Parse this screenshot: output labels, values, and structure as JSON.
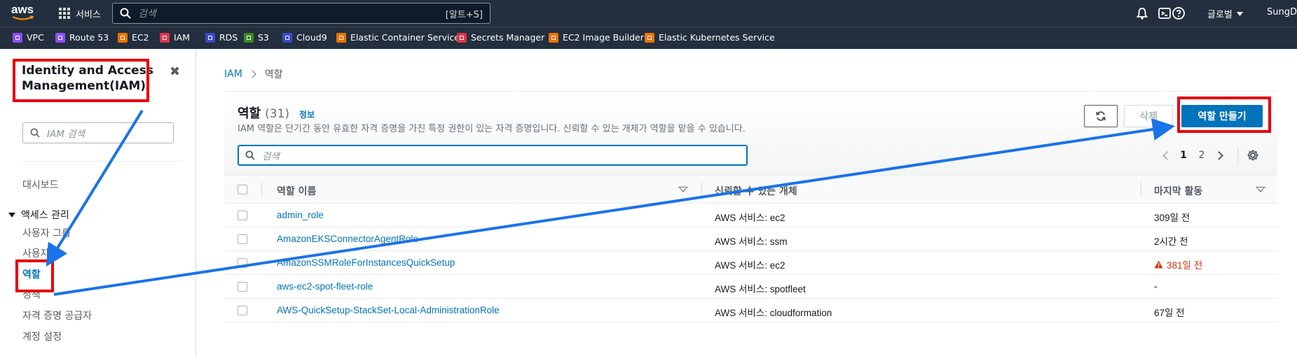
{
  "topnav": {
    "logo_text": "aws",
    "services_label": "서비스",
    "search_placeholder": "검색",
    "search_shortcut": "[알트+S]",
    "region_label": "글로벌",
    "user_label": "SungDa"
  },
  "favorites": [
    {
      "label": "VPC",
      "color": "#8c4fff"
    },
    {
      "label": "Route 53",
      "color": "#8c4fff"
    },
    {
      "label": "EC2",
      "color": "#ed7100"
    },
    {
      "label": "IAM",
      "color": "#dd344c"
    },
    {
      "label": "RDS",
      "color": "#3b48cc"
    },
    {
      "label": "S3",
      "color": "#3f8624"
    },
    {
      "label": "Cloud9",
      "color": "#3b48cc"
    },
    {
      "label": "Elastic Container Service",
      "color": "#ed7100"
    },
    {
      "label": "Secrets Manager",
      "color": "#dd344c"
    },
    {
      "label": "EC2 Image Builder",
      "color": "#ed7100"
    },
    {
      "label": "Elastic Kubernetes Service",
      "color": "#ed7100"
    }
  ],
  "sidebar": {
    "title": "Identity and Access Management(IAM)",
    "close_glyph": "✖",
    "search_placeholder": "IAM 검색",
    "dashboard": "대시보드",
    "group_label": "액세스 관리",
    "items": [
      "사용자 그룹",
      "사용자",
      "역할",
      "정책",
      "자격 증명 공급자",
      "계정 설정"
    ],
    "active_item": "역할"
  },
  "breadcrumb": {
    "root": "IAM",
    "current": "역할"
  },
  "roles_panel": {
    "title": "역할",
    "count": "(31)",
    "info": "정보",
    "description": "IAM 역할은 단기간 동안 유효한 자격 증명을 가진 특정 권한이 있는 자격 증명입니다. 신뢰할 수 있는 개체가 역할을 맡을 수 있습니다.",
    "search_placeholder": "검색",
    "delete_label": "삭제",
    "create_label": "역할 만들기",
    "pages": [
      "1",
      "2"
    ],
    "current_page": "1",
    "columns": [
      "역할 이름",
      "신뢰할 수 있는 개체",
      "마지막 활동"
    ],
    "rows": [
      {
        "name": "admin_role",
        "entity": "AWS 서비스: ec2",
        "activity": "309일 전",
        "warning": false
      },
      {
        "name": "AmazonEKSConnectorAgentRole",
        "entity": "AWS 서비스: ssm",
        "activity": "2시간 전",
        "warning": false
      },
      {
        "name": "AmazonSSMRoleForInstancesQuickSetup",
        "entity": "AWS 서비스: ec2",
        "activity": "381일 전",
        "warning": true
      },
      {
        "name": "aws-ec2-spot-fleet-role",
        "entity": "AWS 서비스: spotfleet",
        "activity": "-",
        "warning": false
      },
      {
        "name": "AWS-QuickSetup-StackSet-Local-AdministrationRole",
        "entity": "AWS 서비스: cloudformation",
        "activity": "67일 전",
        "warning": false
      }
    ]
  },
  "colors": {
    "nav_bg": "#232f3e",
    "link": "#0073bb",
    "primary_button": "#0073bb",
    "highlight": "#e8000b",
    "arrow": "#1a73e8",
    "warning": "#d13212"
  }
}
